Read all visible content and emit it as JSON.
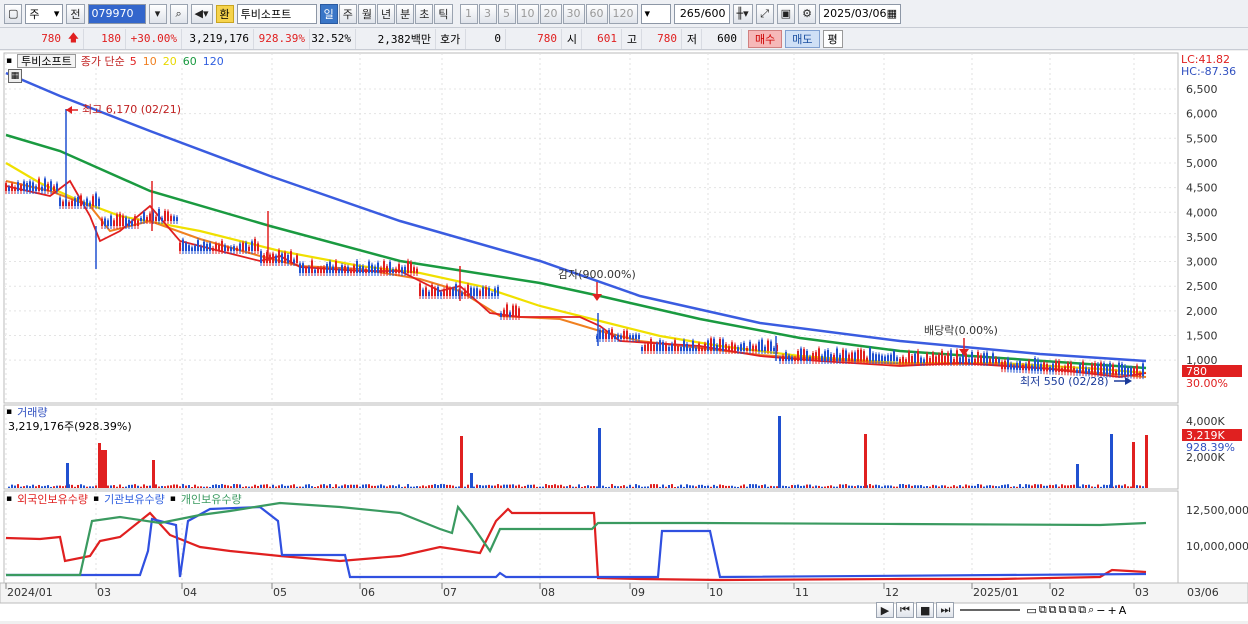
{
  "toolbar": {
    "period": "주",
    "prev": "전",
    "code": "079970",
    "hwan": "환",
    "name": "투비소프트",
    "intervals": [
      {
        "label": "일",
        "selected": true
      },
      {
        "label": "주",
        "selected": false
      },
      {
        "label": "월",
        "selected": false
      },
      {
        "label": "년",
        "selected": false
      },
      {
        "label": "분",
        "selected": false
      },
      {
        "label": "초",
        "selected": false
      },
      {
        "label": "틱",
        "selected": false
      }
    ],
    "numbers": [
      "1",
      "3",
      "5",
      "10",
      "20",
      "30",
      "60",
      "120"
    ],
    "count": "265",
    "count_total": "/600",
    "date": "2025/03/06"
  },
  "quote": {
    "price": "780",
    "change": "180",
    "rate": "+30.00%",
    "volume": "3,219,176",
    "vol_rate": "928.39%",
    "turnover": "32.52%",
    "amount": "2,382백만",
    "hoga_label": "호가",
    "hoga": "0",
    "hoga_price": "780",
    "open_label": "시",
    "open": "601",
    "high_label": "고",
    "high": "780",
    "low_label": "저",
    "low": "600",
    "buy": "매수",
    "sell": "매도",
    "eval": "평"
  },
  "legend": {
    "tab": "투비소프트",
    "title": "종가 단순",
    "ma": [
      {
        "label": "5",
        "color": "#e02020"
      },
      {
        "label": "10",
        "color": "#f08020"
      },
      {
        "label": "20",
        "color": "#e8d800"
      },
      {
        "label": "60",
        "color": "#1a9a40"
      },
      {
        "label": "120",
        "color": "#3060e0"
      }
    ]
  },
  "right_info": {
    "lc": "LC:41.82",
    "hc": "HC:-87.36"
  },
  "y_ticks": [
    "6,500",
    "6,000",
    "5,500",
    "5,000",
    "4,500",
    "4,000",
    "3,500",
    "3,000",
    "2,500",
    "2,000",
    "1,500",
    "1,000"
  ],
  "price_tag": {
    "price": "780",
    "rate": "30.00%"
  },
  "annotations": {
    "high": "최고 6,170 (02/21)",
    "reduction": "감자(900.00%)",
    "dividend": "배당락(0.00%)",
    "low": "최저 550 (02/28)"
  },
  "volume_panel": {
    "title": "거래량",
    "sub": "3,219,176주(928.39%)",
    "y_ticks": [
      "4,000K",
      "2,000K"
    ],
    "tag_value": "3,219K",
    "tag_rate": "928.39%"
  },
  "holding_panel": {
    "series": [
      {
        "label": "외국인보유수량",
        "color": "#e02020"
      },
      {
        "label": "기관보유수량",
        "color": "#3060e0"
      },
      {
        "label": "개인보유수량",
        "color": "#3a9a60"
      }
    ],
    "y_ticks": [
      "12,500,000",
      "10,000,000"
    ]
  },
  "x_axis": [
    "2024/01",
    "03",
    "04",
    "05",
    "06",
    "07",
    "08",
    "09",
    "10",
    "11",
    "12",
    "2025/01",
    "02",
    "03",
    "03/06"
  ]
}
